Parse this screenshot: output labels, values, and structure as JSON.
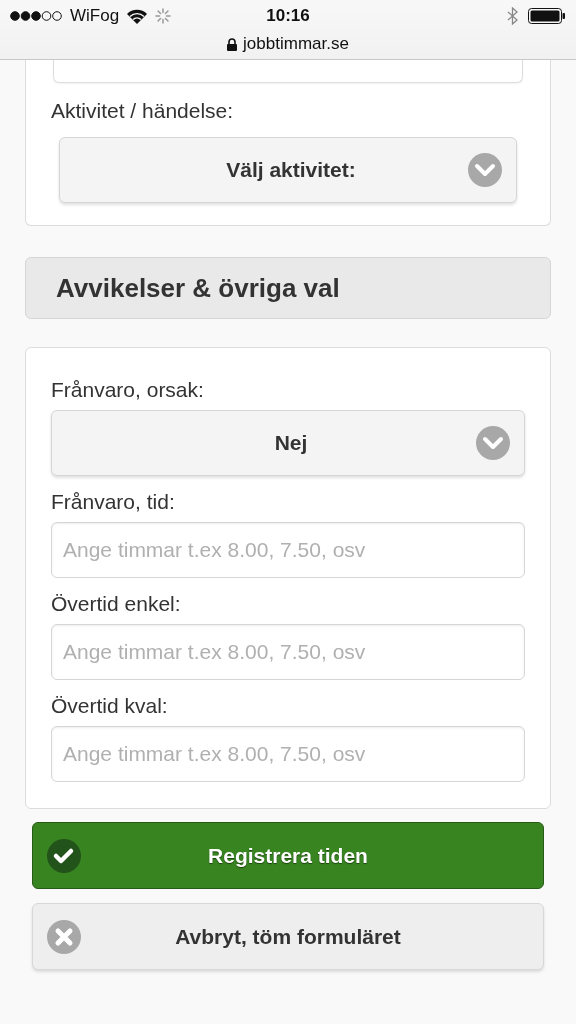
{
  "status_bar": {
    "carrier": "WiFog",
    "time": "10:16",
    "url": "jobbtimmar.se"
  },
  "activity": {
    "label": "Aktivitet / händelse:",
    "select": "Välj aktivitet:"
  },
  "section": {
    "title": "Avvikelser & övriga val"
  },
  "fields": [
    {
      "kind": "select",
      "label": "Frånvaro, orsak:",
      "value": "Nej"
    },
    {
      "kind": "input",
      "label": "Frånvaro, tid:",
      "placeholder": "Ange timmar t.ex 8.00, 7.50, osv"
    },
    {
      "kind": "input",
      "label": "Övertid enkel:",
      "placeholder": "Ange timmar t.ex 8.00, 7.50, osv"
    },
    {
      "kind": "input",
      "label": "Övertid kval:",
      "placeholder": "Ange timmar t.ex 8.00, 7.50, osv"
    }
  ],
  "buttons": [
    {
      "kind": "primary",
      "label": "Registrera tiden"
    },
    {
      "kind": "cancel",
      "label": "Avbryt, töm formuläret"
    }
  ]
}
